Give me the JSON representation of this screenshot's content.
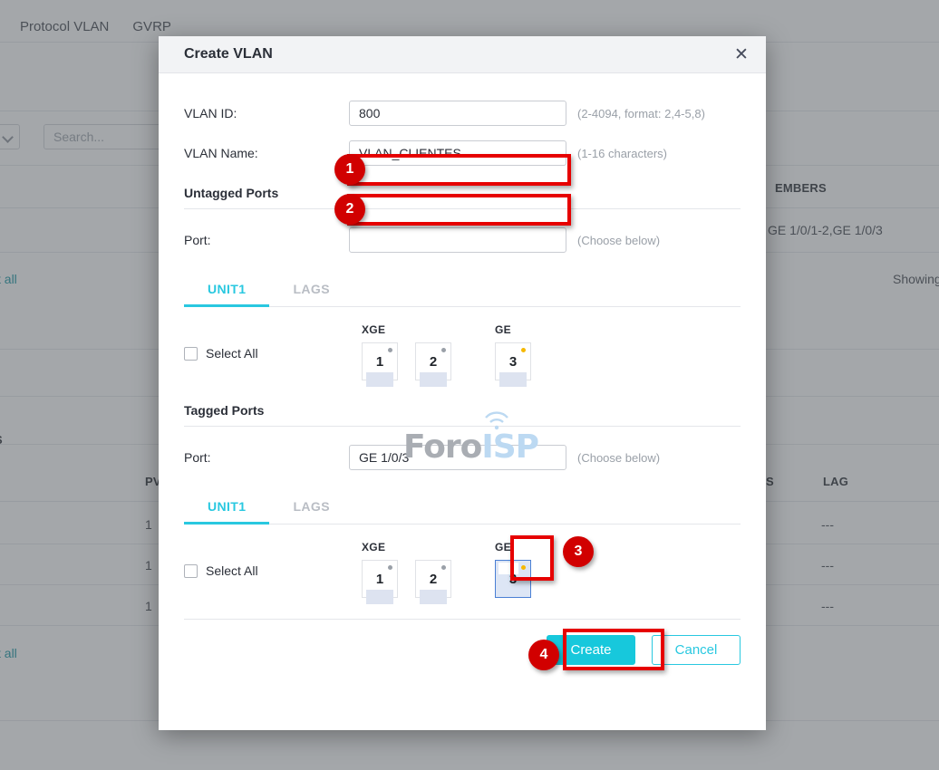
{
  "background": {
    "tabs": [
      {
        "label": "Protocol VLAN"
      },
      {
        "label": "GVRP"
      }
    ],
    "search_placeholder": "Search...",
    "links": [
      {
        "label": "t all"
      },
      {
        "label": "t all"
      }
    ],
    "column_headers": [
      {
        "label": "EMBERS"
      },
      {
        "label": "PV"
      },
      {
        "label": "S"
      },
      {
        "label": "LAG"
      },
      {
        "label": "S"
      }
    ],
    "cells": [
      {
        "label": "GE 1/0/1-2,GE 1/0/3"
      },
      {
        "label": "Showing"
      },
      {
        "label": "1"
      },
      {
        "label": "1"
      },
      {
        "label": "1"
      },
      {
        "label": "---"
      },
      {
        "label": "---"
      },
      {
        "label": "---"
      }
    ]
  },
  "dialog": {
    "title": "Create VLAN",
    "close_icon": "close-icon",
    "fields": {
      "vlan_id": {
        "label": "VLAN ID:",
        "value": "800",
        "hint": "(2-4094, format: 2,4-5,8)"
      },
      "vlan_name": {
        "label": "VLAN Name:",
        "value": "VLAN_CLIENTES",
        "hint": "(1-16 characters)"
      }
    },
    "untagged": {
      "section_title": "Untagged Ports",
      "port_label": "Port:",
      "port_value": "",
      "port_placeholder": "",
      "port_hint": "(Choose below)",
      "tabs": [
        {
          "label": "UNIT1",
          "active": true
        },
        {
          "label": "LAGS",
          "active": false
        }
      ],
      "select_all_label": "Select All",
      "groups": [
        {
          "name": "XGE",
          "ports": [
            {
              "num": "1",
              "selected": false,
              "link": false
            },
            {
              "num": "2",
              "selected": false,
              "link": false
            }
          ]
        },
        {
          "name": "GE",
          "ports": [
            {
              "num": "3",
              "selected": false,
              "link": true
            }
          ]
        }
      ]
    },
    "tagged": {
      "section_title": "Tagged Ports",
      "port_label": "Port:",
      "port_value": "GE 1/0/3",
      "port_hint": "(Choose below)",
      "tabs": [
        {
          "label": "UNIT1",
          "active": true
        },
        {
          "label": "LAGS",
          "active": false
        }
      ],
      "select_all_label": "Select All",
      "groups": [
        {
          "name": "XGE",
          "ports": [
            {
              "num": "1",
              "selected": false,
              "link": false
            },
            {
              "num": "2",
              "selected": false,
              "link": false
            }
          ]
        },
        {
          "name": "GE",
          "ports": [
            {
              "num": "3",
              "selected": true,
              "link": true
            }
          ]
        }
      ]
    },
    "footer": {
      "create_label": "Create",
      "cancel_label": "Cancel"
    }
  },
  "annotations": {
    "markers": [
      {
        "number": "1"
      },
      {
        "number": "2"
      },
      {
        "number": "3"
      },
      {
        "number": "4"
      }
    ]
  },
  "watermark": {
    "part1": "Foro",
    "part2": "ISP"
  },
  "colors": {
    "accent": "#29c8e0",
    "create_button": "#17c8dc",
    "annotation_red": "#d10000",
    "highlight_border": "#e60000",
    "link_dot_active": "#f5b800",
    "port_selected_border": "#4a7fd4"
  }
}
